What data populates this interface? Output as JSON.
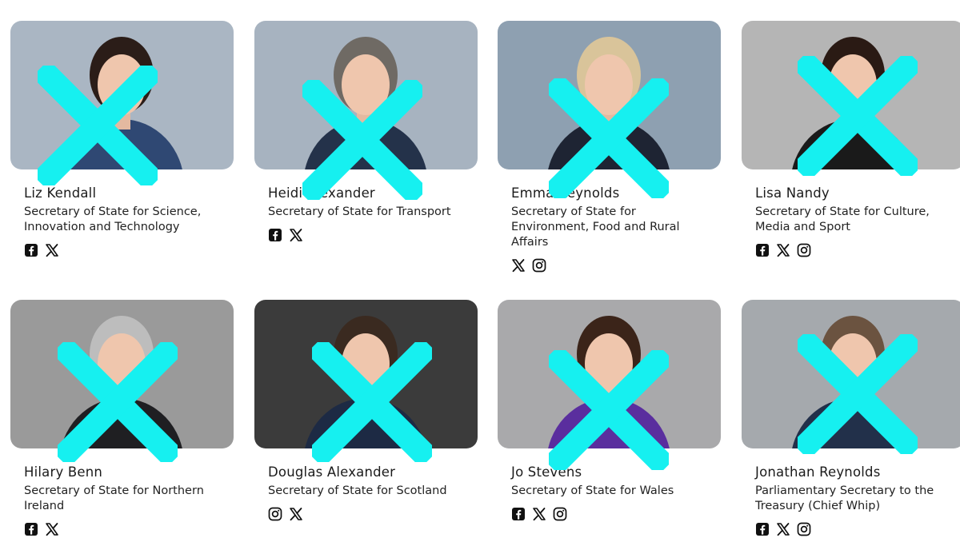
{
  "cards": [
    {
      "name": "Liz Kendall",
      "role": "Secretary of State for Science, Innovation and Technology",
      "photo_bg": "#aab6c3",
      "clothing": "#2f4873",
      "hair": "#2b1d18",
      "socials": [
        "facebook-icon",
        "x-icon"
      ]
    },
    {
      "name": "Heidi Alexander",
      "role": "Secretary of State for Transport",
      "photo_bg": "#a7b3c0",
      "clothing": "#24324a",
      "hair": "#6f6a64",
      "socials": [
        "facebook-icon",
        "x-icon"
      ]
    },
    {
      "name": "Emma Reynolds",
      "role": "Secretary of State for Environment, Food and Rural Affairs",
      "photo_bg": "#8ea0b1",
      "clothing": "#1e2433",
      "hair": "#d9c49a",
      "socials": [
        "x-icon",
        "instagram-icon"
      ]
    },
    {
      "name": "Lisa Nandy",
      "role": "Secretary of State for Culture, Media and Sport",
      "photo_bg": "#b5b5b5",
      "clothing": "#1a1a1a",
      "hair": "#2a1a14",
      "socials": [
        "facebook-icon",
        "x-icon",
        "instagram-icon"
      ]
    },
    {
      "name": "Hilary Benn",
      "role": "Secretary of State for Northern Ireland",
      "photo_bg": "#9a9a9a",
      "clothing": "#1f1f22",
      "hair": "#bdbdbd",
      "socials": [
        "facebook-icon",
        "x-icon"
      ]
    },
    {
      "name": "Douglas Alexander",
      "role": "Secretary of State for Scotland",
      "photo_bg": "#3b3b3b",
      "clothing": "#1d2a44",
      "hair": "#3a2a20",
      "socials": [
        "instagram-icon",
        "x-icon"
      ]
    },
    {
      "name": "Jo Stevens",
      "role": "Secretary of State for Wales",
      "photo_bg": "#a9a9ab",
      "clothing": "#5a2e9e",
      "hair": "#3b2419",
      "socials": [
        "facebook-icon",
        "x-icon",
        "instagram-icon"
      ]
    },
    {
      "name": "Jonathan Reynolds",
      "role": "Parliamentary Secretary to the Treasury (Chief Whip)",
      "photo_bg": "#a5a9ad",
      "clothing": "#22304a",
      "hair": "#6b5340",
      "socials": [
        "facebook-icon",
        "x-icon",
        "instagram-icon"
      ]
    }
  ],
  "cross_color": "#16f0f0"
}
